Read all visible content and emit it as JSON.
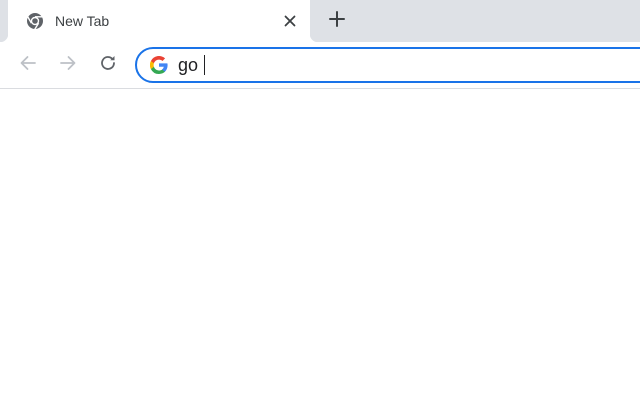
{
  "tab": {
    "title": "New Tab",
    "favicon": "chrome-icon"
  },
  "tabstrip": {
    "close_icon": "close-icon",
    "new_tab_icon": "plus-icon"
  },
  "toolbar": {
    "back_icon": "arrow-left-icon",
    "forward_icon": "arrow-right-icon",
    "reload_icon": "reload-icon"
  },
  "omnibox": {
    "value": "go",
    "engine_icon": "google-icon",
    "focus_color": "#1a73e8"
  },
  "colors": {
    "tabstrip_bg": "#dee1e6",
    "tab_bg": "#ffffff",
    "icon_disabled": "#bdc1c6",
    "icon_active": "#5f6368"
  }
}
